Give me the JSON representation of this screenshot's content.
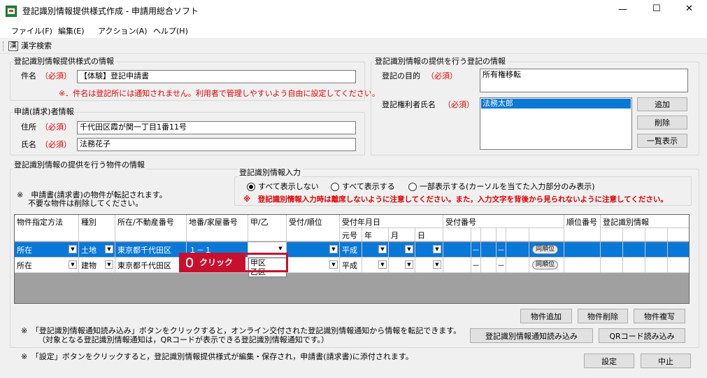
{
  "window": {
    "title": "登記識別情報提供様式作成 - 申請用総合ソフト",
    "minimize": "—",
    "maximize": "☐",
    "close": "✕"
  },
  "menu": [
    "ファイル(F)",
    "編集(E)",
    "アクション(A)",
    "ヘルプ(H)"
  ],
  "toolbar": {
    "kanji_search": "漢字検索"
  },
  "form_info": {
    "legend": "登記識別情報提供様式の情報",
    "subject_label": "件名",
    "required": "（必須）",
    "subject_value": "【体験】登記申請書",
    "subject_note": "※．件名は登記所には通知されません。利用者で管理しやすいよう自由に設定してください。"
  },
  "applicant": {
    "legend": "申請(請求)者情報",
    "address_label": "住所",
    "address_value": "千代田区霞が関一丁目1番11号",
    "name_label": "氏名",
    "name_value": "法務花子"
  },
  "registration": {
    "legend": "登記識別情報の提供を行う登記の情報",
    "purpose_label": "登記の目的",
    "purpose_value": "所有権移転",
    "holder_label": "登記権利者氏名",
    "holder_value": "法務太郎",
    "add_button": "追加",
    "delete_button": "削除",
    "list_button": "一覧表示"
  },
  "property": {
    "legend": "登記識別情報の提供を行う物件の情報",
    "note1": "※　申請書(請求書)の物件が転記されます。",
    "note2": "不要な物件は削除してください。"
  },
  "input": {
    "legend": "登記識別情報入力",
    "radio1": "すべて表示しない",
    "radio2": "すべて表示する",
    "radio3": "一部表示する(カーソルを当てた入力部分のみ表示)",
    "warning": "※　登記識別情報入力時は離席しないように注意してください。また，入力文字を背後から見られないように注意してください。"
  },
  "grid": {
    "headers": {
      "method": "物件指定方法",
      "kind": "種別",
      "location": "所在/不動産番号",
      "lot": "地番/家屋番号",
      "kou_otsu": "甲/乙",
      "order": "受付/順位",
      "date": "受付年月日",
      "era": "元号",
      "year": "年",
      "month": "月",
      "day": "日",
      "receipt": "受付番号",
      "rank": "順位番号",
      "ident": "登記識別情報"
    },
    "rows": [
      {
        "method": "所在",
        "kind": "土地",
        "location": "東京都千代田区",
        "lot": "１－１",
        "era": "平成",
        "dash1": "－",
        "dash2": "－",
        "same": "同順位"
      },
      {
        "method": "所在",
        "kind": "建物",
        "location": "東京都千代田区",
        "kou": "甲区",
        "era": "平成",
        "dash1": "－",
        "dash2": "－",
        "same": "同順位"
      }
    ],
    "dropdown_options": [
      "甲区",
      "乙区"
    ],
    "click_label": "クリック"
  },
  "buttons": {
    "add_property": "物件追加",
    "delete_property": "物件削除",
    "copy_property": "物件複写",
    "read_notice": "登記識別情報通知読み込み",
    "read_qr": "QRコード読み込み",
    "settings": "設定",
    "cancel": "中止"
  },
  "footer": {
    "note1": "※　「登記識別情報通知読み込み」ボタンをクリックすると，オンライン交付された登記識別情報通知から情報を転記できます。",
    "note2": "（対象となる登記識別情報通知は，QRコードが表示できる登記識別情報通知です。）",
    "note3": "※　「設定」ボタンをクリックすると，登記識別情報提供様式が編集・保存され，申請書(請求書)に添付されます。"
  }
}
